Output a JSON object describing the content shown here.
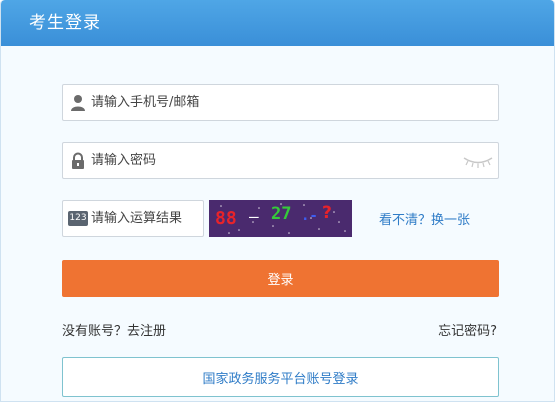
{
  "header": {
    "title": "考生登录"
  },
  "form": {
    "phone_placeholder": "请输入手机号/邮箱",
    "password_placeholder": "请输入密码",
    "captcha_placeholder": "请输入运算结果",
    "captcha_badge": "123",
    "captcha_text": {
      "n1": "88",
      "op": "—",
      "n2": "27",
      "tail": ".-",
      "q": "?"
    },
    "refresh_label": "看不清？换一张",
    "login_label": "登录"
  },
  "links": {
    "register": "没有账号？去注册",
    "forgot": "忘记密码?"
  },
  "gov_login_label": "国家政务服务平台账号登录",
  "colors": {
    "header": "#3a8fd8",
    "login_button": "#ef7332",
    "link": "#2f7cc7",
    "captcha_bg": "#4a2a6e"
  },
  "icons": {
    "user": "user-icon",
    "lock": "lock-icon",
    "eye": "eye-closed-icon"
  }
}
